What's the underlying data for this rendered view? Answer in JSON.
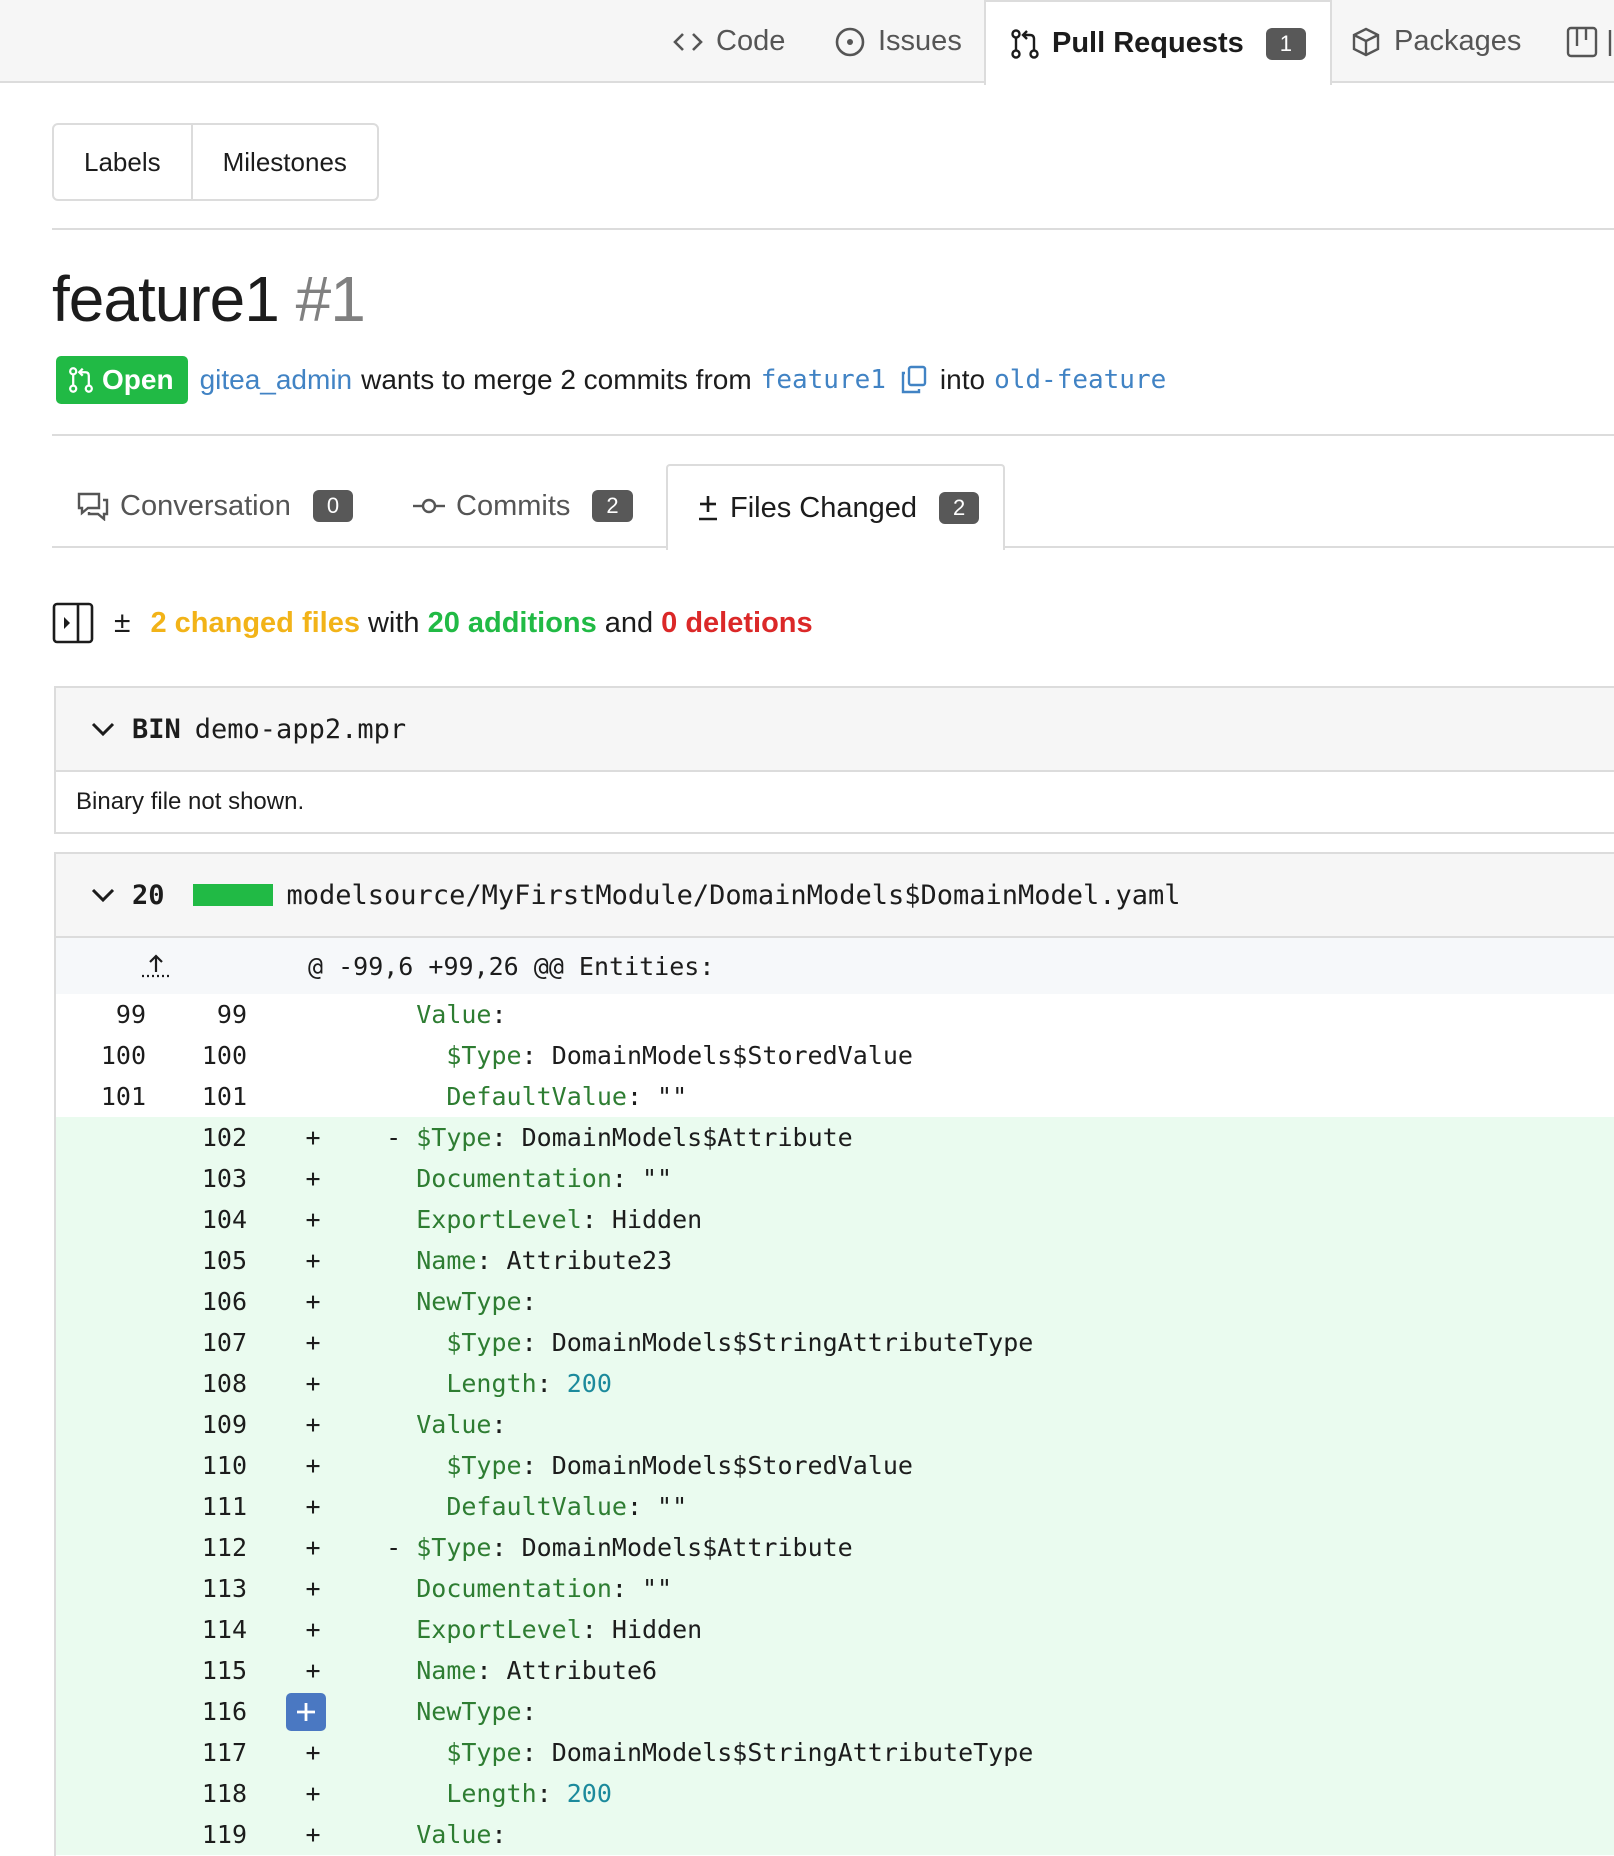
{
  "repo_nav": {
    "tabs": [
      {
        "label": "Code",
        "icon": "code-icon"
      },
      {
        "label": "Issues",
        "icon": "issue-icon"
      },
      {
        "label": "Pull Requests",
        "icon": "pull-request-icon",
        "count": "1",
        "active": true
      },
      {
        "label": "Packages",
        "icon": "package-icon"
      }
    ]
  },
  "filters": {
    "labels": "Labels",
    "milestones": "Milestones"
  },
  "pr": {
    "title": "feature1",
    "number": "#1",
    "status": "Open",
    "author": "gitea_admin",
    "merge_text": "wants to merge 2 commits from",
    "head_branch": "feature1",
    "into_text": "into",
    "base_branch": "old-feature"
  },
  "pr_tabs": [
    {
      "label": "Conversation",
      "count": "0",
      "icon": "comment-icon"
    },
    {
      "label": "Commits",
      "count": "2",
      "icon": "commit-icon"
    },
    {
      "label": "Files Changed",
      "count": "2",
      "icon": "diff-icon",
      "active": true
    }
  ],
  "summary": {
    "pm": "±",
    "changed": "2 changed files",
    "with": "with",
    "additions": "20 additions",
    "and": "and",
    "deletions": "0 deletions"
  },
  "files": [
    {
      "badge": "BIN",
      "name": "demo-app2.mpr",
      "message": "Binary file not shown."
    },
    {
      "badge": "20",
      "name": "modelsource/MyFirstModule/DomainModels$DomainModel.yaml"
    }
  ],
  "hunk_header": "@ -99,6 +99,26 @@ Entities:",
  "diff_lines": [
    {
      "old": "99",
      "new": "99",
      "sign": "",
      "indent": "    ",
      "key": "Value",
      "sep": ":",
      "val": ""
    },
    {
      "old": "100",
      "new": "100",
      "sign": "",
      "indent": "      ",
      "key": "$Type",
      "sep": ": ",
      "val": "DomainModels$StoredValue"
    },
    {
      "old": "101",
      "new": "101",
      "sign": "",
      "indent": "      ",
      "key": "DefaultValue",
      "sep": ": ",
      "val": "\"\""
    },
    {
      "old": "",
      "new": "102",
      "sign": "+",
      "indent": "  - ",
      "key": "$Type",
      "sep": ": ",
      "val": "DomainModels$Attribute"
    },
    {
      "old": "",
      "new": "103",
      "sign": "+",
      "indent": "    ",
      "key": "Documentation",
      "sep": ": ",
      "val": "\"\""
    },
    {
      "old": "",
      "new": "104",
      "sign": "+",
      "indent": "    ",
      "key": "ExportLevel",
      "sep": ": ",
      "val": "Hidden"
    },
    {
      "old": "",
      "new": "105",
      "sign": "+",
      "indent": "    ",
      "key": "Name",
      "sep": ": ",
      "val": "Attribute23"
    },
    {
      "old": "",
      "new": "106",
      "sign": "+",
      "indent": "    ",
      "key": "NewType",
      "sep": ":",
      "val": ""
    },
    {
      "old": "",
      "new": "107",
      "sign": "+",
      "indent": "      ",
      "key": "$Type",
      "sep": ": ",
      "val": "DomainModels$StringAttributeType"
    },
    {
      "old": "",
      "new": "108",
      "sign": "+",
      "indent": "      ",
      "key": "Length",
      "sep": ": ",
      "val": "200",
      "num": true
    },
    {
      "old": "",
      "new": "109",
      "sign": "+",
      "indent": "    ",
      "key": "Value",
      "sep": ":",
      "val": ""
    },
    {
      "old": "",
      "new": "110",
      "sign": "+",
      "indent": "      ",
      "key": "$Type",
      "sep": ": ",
      "val": "DomainModels$StoredValue"
    },
    {
      "old": "",
      "new": "111",
      "sign": "+",
      "indent": "      ",
      "key": "DefaultValue",
      "sep": ": ",
      "val": "\"\""
    },
    {
      "old": "",
      "new": "112",
      "sign": "+",
      "indent": "  - ",
      "key": "$Type",
      "sep": ": ",
      "val": "DomainModels$Attribute"
    },
    {
      "old": "",
      "new": "113",
      "sign": "+",
      "indent": "    ",
      "key": "Documentation",
      "sep": ": ",
      "val": "\"\""
    },
    {
      "old": "",
      "new": "114",
      "sign": "+",
      "indent": "    ",
      "key": "ExportLevel",
      "sep": ": ",
      "val": "Hidden"
    },
    {
      "old": "",
      "new": "115",
      "sign": "+",
      "indent": "    ",
      "key": "Name",
      "sep": ": ",
      "val": "Attribute6"
    },
    {
      "old": "",
      "new": "116",
      "sign": "+",
      "indent": "    ",
      "key": "NewType",
      "sep": ":",
      "val": "",
      "hover_add_button": true
    },
    {
      "old": "",
      "new": "117",
      "sign": "+",
      "indent": "      ",
      "key": "$Type",
      "sep": ": ",
      "val": "DomainModels$StringAttributeType"
    },
    {
      "old": "",
      "new": "118",
      "sign": "+",
      "indent": "      ",
      "key": "Length",
      "sep": ": ",
      "val": "200",
      "num": true
    },
    {
      "old": "",
      "new": "119",
      "sign": "+",
      "indent": "    ",
      "key": "Value",
      "sep": ":",
      "val": ""
    }
  ],
  "colors": {
    "open_badge": "#21ba45",
    "link": "#4183c4",
    "changed_files": "#f2b318",
    "additions": "#21ba45",
    "deletions": "#db2828",
    "added_line_bg": "#eafbef",
    "yaml_key": "#2e7d32",
    "yaml_number": "#1c8a9c"
  }
}
